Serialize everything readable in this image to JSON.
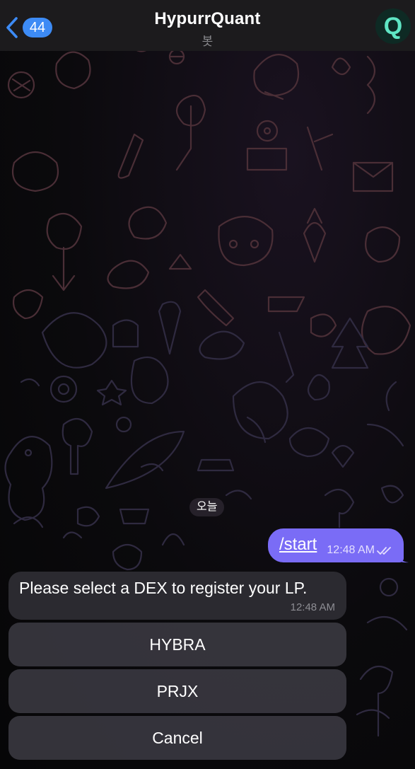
{
  "header": {
    "back_count": "44",
    "title": "HypurrQuant",
    "subtitle": "봇",
    "avatar_letter": "Q"
  },
  "chat": {
    "date_label": "오늘",
    "outgoing": {
      "text": "/start",
      "time": "12:48 AM",
      "status_icon": "double-check-icon"
    },
    "incoming": {
      "text": "Please select a DEX to register your LP.",
      "time": "12:48 AM"
    },
    "inline_buttons": [
      "HYBRA",
      "PRJX",
      "Cancel"
    ]
  },
  "colors": {
    "accent": "#3d8bf5",
    "outgoing_bubble": "#7a6cf6",
    "incoming_bubble": "#2b2a30",
    "header_bg": "#1c1b1d",
    "avatar_letter": "#5fe6c4"
  }
}
